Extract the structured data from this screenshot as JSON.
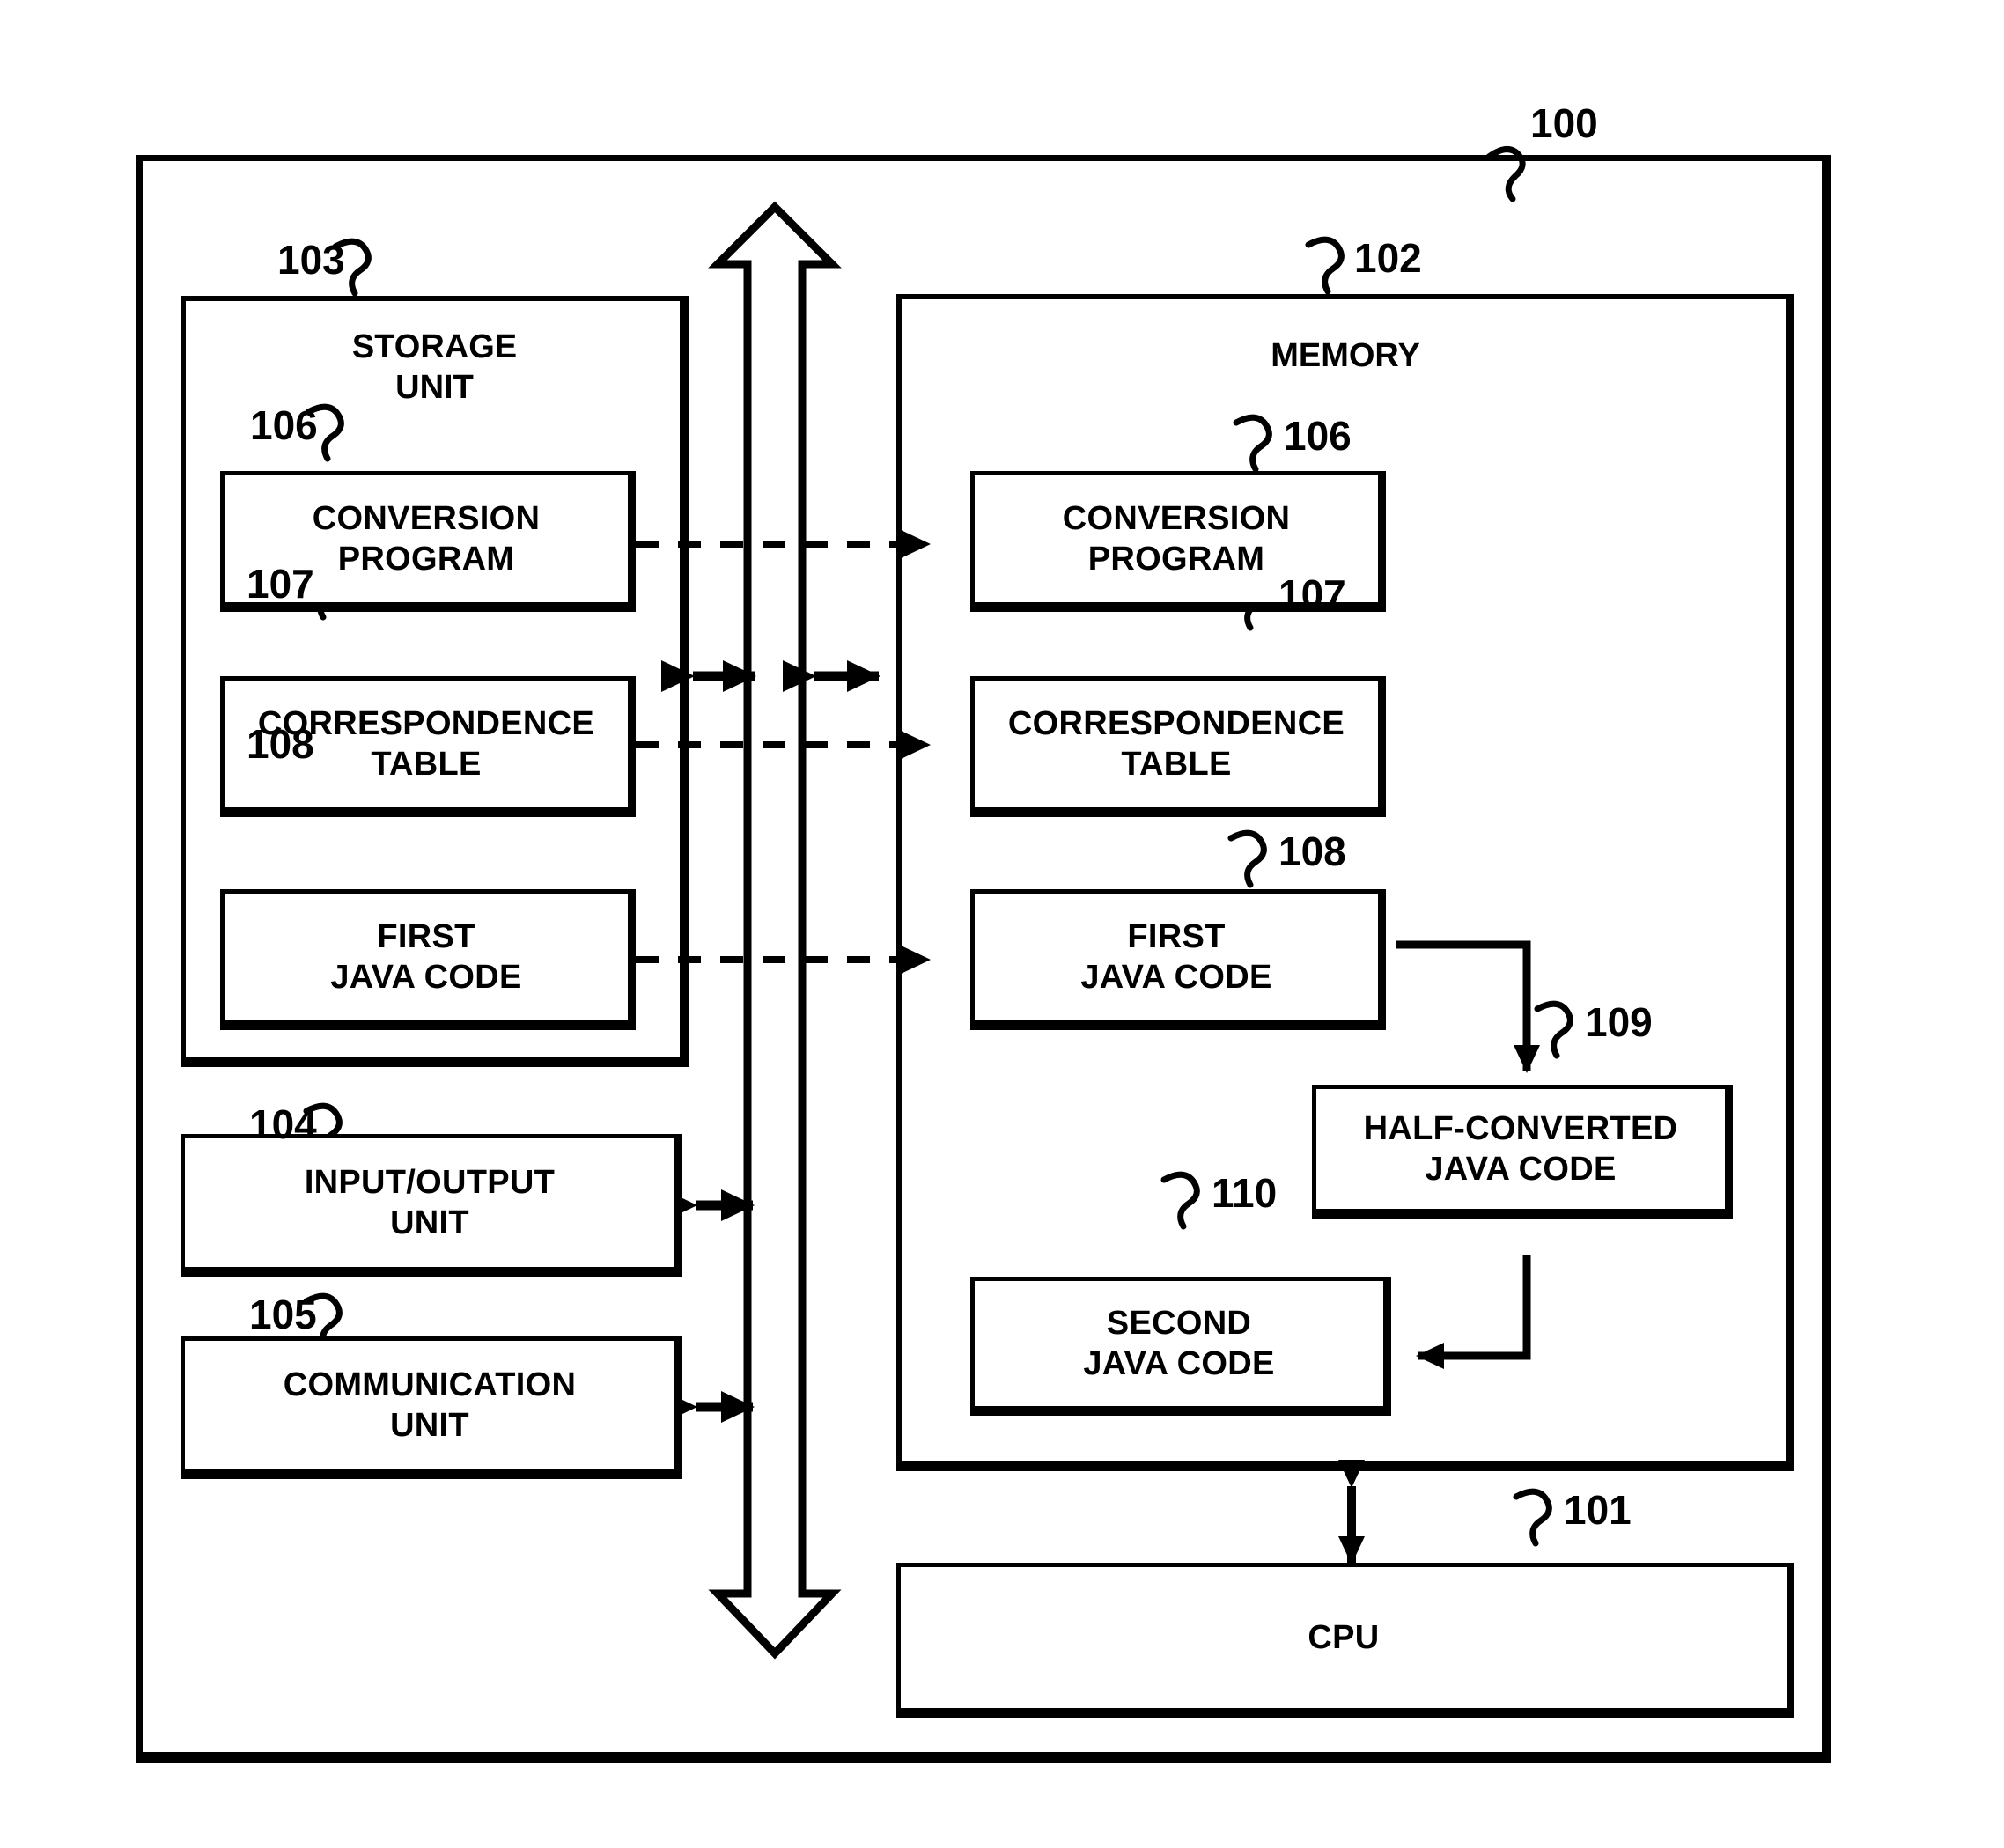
{
  "figure": {
    "type": "patent-block-diagram",
    "background": "#ffffff",
    "line_color": "#000000"
  },
  "refs": {
    "system": "100",
    "cpu": "101",
    "memory": "102",
    "storage_unit": "103",
    "io_unit": "104",
    "communication_unit": "105",
    "conversion_program": "106",
    "correspondence_table": "107",
    "first_java_code": "108",
    "half_converted_java_code": "109",
    "second_java_code": "110"
  },
  "storage_unit": {
    "title": "STORAGE\nUNIT",
    "ref": "103",
    "items": [
      {
        "ref": "106",
        "label": "CONVERSION\nPROGRAM"
      },
      {
        "ref": "107",
        "label": "CORRESPONDENCE\nTABLE"
      },
      {
        "ref": "108",
        "label": "FIRST\nJAVA CODE"
      }
    ]
  },
  "peripherals": [
    {
      "ref": "104",
      "label": "INPUT/OUTPUT\nUNIT"
    },
    {
      "ref": "105",
      "label": "COMMUNICATION\nUNIT"
    }
  ],
  "memory": {
    "title": "MEMORY",
    "ref": "102",
    "items": [
      {
        "ref": "106",
        "label": "CONVERSION\nPROGRAM"
      },
      {
        "ref": "107",
        "label": "CORRESPONDENCE\nTABLE"
      },
      {
        "ref": "108",
        "label": "FIRST\nJAVA CODE"
      },
      {
        "ref": "109",
        "label": "HALF-CONVERTED\nJAVA CODE"
      },
      {
        "ref": "110",
        "label": "SECOND\nJAVA CODE"
      }
    ]
  },
  "cpu": {
    "label": "CPU",
    "ref": "101"
  },
  "bus": {
    "name": "system-bus",
    "style": "hollow-double-headed-vertical-arrow"
  },
  "connections": [
    {
      "from": "storage.conversion-program",
      "to": "memory.conversion-program",
      "style": "dashed-arrow"
    },
    {
      "from": "storage.correspondence-table",
      "to": "memory.correspondence-table",
      "style": "dashed-arrow"
    },
    {
      "from": "storage.first-java-code",
      "to": "memory.first-java-code",
      "style": "dashed-arrow"
    },
    {
      "from": "storage-unit",
      "to": "bus",
      "style": "solid-double-headed-arrow"
    },
    {
      "from": "bus",
      "to": "memory",
      "style": "solid-double-headed-arrow"
    },
    {
      "from": "input-output-unit",
      "to": "bus",
      "style": "solid-double-headed-arrow"
    },
    {
      "from": "communication-unit",
      "to": "bus",
      "style": "solid-double-headed-arrow"
    },
    {
      "from": "memory",
      "to": "cpu",
      "style": "solid-double-headed-arrow"
    },
    {
      "from": "memory.first-java-code",
      "to": "memory.half-converted-java-code",
      "style": "solid-arrow"
    },
    {
      "from": "memory.half-converted-java-code",
      "to": "memory.second-java-code",
      "style": "solid-arrow"
    }
  ]
}
